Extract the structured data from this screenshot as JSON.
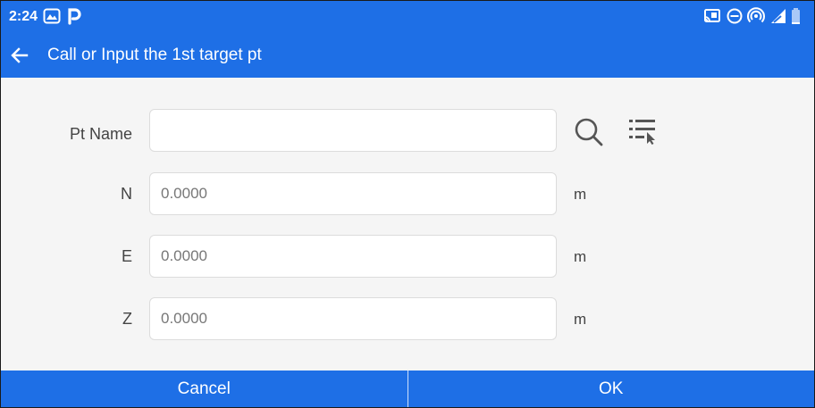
{
  "status_bar": {
    "time": "2:24",
    "left_icons": [
      "gallery-app-icon",
      "parking-app-icon"
    ],
    "right_icons": [
      "cast-icon",
      "do-not-disturb-icon",
      "hotspot-icon",
      "signal-icon",
      "battery-icon"
    ],
    "battery_level": 0.15
  },
  "header": {
    "title": "Call or Input the 1st target pt",
    "back_icon": "back-arrow-icon"
  },
  "form": {
    "pt_name": {
      "label": "Pt Name",
      "value": "",
      "placeholder": "",
      "search_icon": "search-icon",
      "list_icon": "point-list-icon"
    },
    "n": {
      "label": "N",
      "placeholder": "0.0000",
      "unit": "m"
    },
    "e": {
      "label": "E",
      "placeholder": "0.0000",
      "unit": "m"
    },
    "z": {
      "label": "Z",
      "placeholder": "0.0000",
      "unit": "m"
    }
  },
  "footer": {
    "cancel_label": "Cancel",
    "ok_label": "OK"
  },
  "colors": {
    "accent": "#1e6fe6",
    "background": "#f5f5f5",
    "field_border": "#dcdcdc",
    "text": "#444444"
  }
}
